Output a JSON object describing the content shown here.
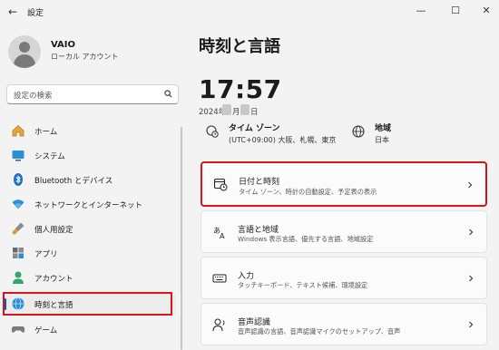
{
  "window": {
    "title": "設定",
    "back_icon": "←",
    "minimize_icon": "—",
    "maximize_icon": "☐",
    "close_icon": "✕"
  },
  "user": {
    "name": "VAIO",
    "account_type": "ローカル アカウント"
  },
  "search": {
    "placeholder": "設定の検索"
  },
  "nav": {
    "items": [
      {
        "label": "ホーム",
        "icon": "home-icon"
      },
      {
        "label": "システム",
        "icon": "system-icon"
      },
      {
        "label": "Bluetooth とデバイス",
        "icon": "bluetooth-icon"
      },
      {
        "label": "ネットワークとインターネット",
        "icon": "wifi-icon"
      },
      {
        "label": "個人用設定",
        "icon": "brush-icon"
      },
      {
        "label": "アプリ",
        "icon": "apps-icon"
      },
      {
        "label": "アカウント",
        "icon": "account-icon"
      },
      {
        "label": "時刻と言語",
        "icon": "time-language-icon",
        "selected": true
      },
      {
        "label": "ゲーム",
        "icon": "game-icon"
      }
    ]
  },
  "main": {
    "title": "時刻と言語",
    "time": "17:57",
    "date_year": "2024年",
    "date_month_suffix": "月",
    "date_day_suffix": "日",
    "timezone": {
      "label": "タイム ゾーン",
      "value": "(UTC+09:00) 大阪、札幌、東京"
    },
    "region": {
      "label": "地域",
      "value": "日本"
    },
    "cards": [
      {
        "title": "日付と時刻",
        "subtitle": "タイム ゾーン、時計の自動設定、予定表の表示",
        "icon": "calendar-clock-icon"
      },
      {
        "title": "言語と地域",
        "subtitle": "Windows 表示言語、優先する言語、地域設定",
        "icon": "language-icon"
      },
      {
        "title": "入力",
        "subtitle": "タッチキーボード、テキスト候補、環境設定",
        "icon": "keyboard-icon"
      },
      {
        "title": "音声認識",
        "subtitle": "音声認識の言語、音声認識マイクのセットアップ、音声",
        "icon": "speech-icon"
      }
    ]
  },
  "colors": {
    "accent": "#005fb8",
    "highlight_border": "#d6151c",
    "background": "#f3f3f3"
  }
}
